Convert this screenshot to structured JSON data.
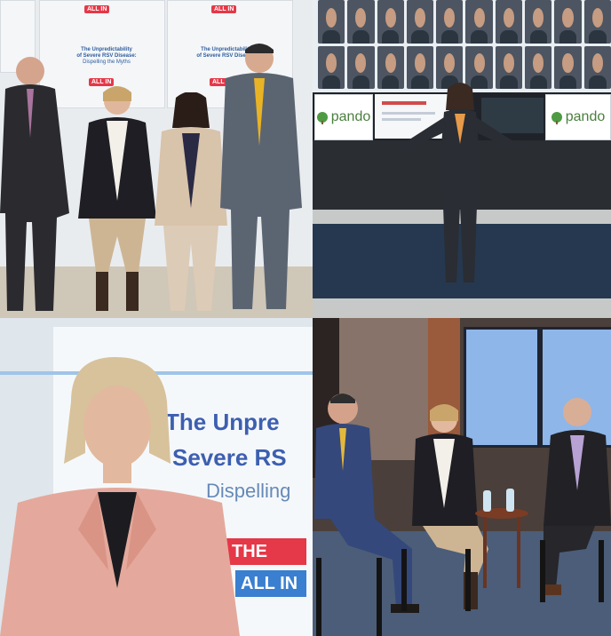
{
  "panels": {
    "top_left": {
      "backdrop": {
        "badge_text": "ALL IN",
        "banner_title_1": "The Unpredictability",
        "banner_title_2": "of Severe RSV Disease:",
        "banner_subtitle": "Dispelling the Myths"
      }
    },
    "top_right": {
      "logo_left": "pando",
      "logo_right": "pando"
    },
    "bottom_left": {
      "screen_line_1": "The Unpre",
      "screen_line_2": "Severe RS",
      "screen_line_3": "Dispelling",
      "screen_badge_1": "THE VOIC",
      "screen_badge_2": "ALL IN"
    },
    "bottom_right": {}
  },
  "colors": {
    "brand_red": "#e53848",
    "brand_blue": "#2f5d9e",
    "pando_green": "#4a7f3d"
  }
}
